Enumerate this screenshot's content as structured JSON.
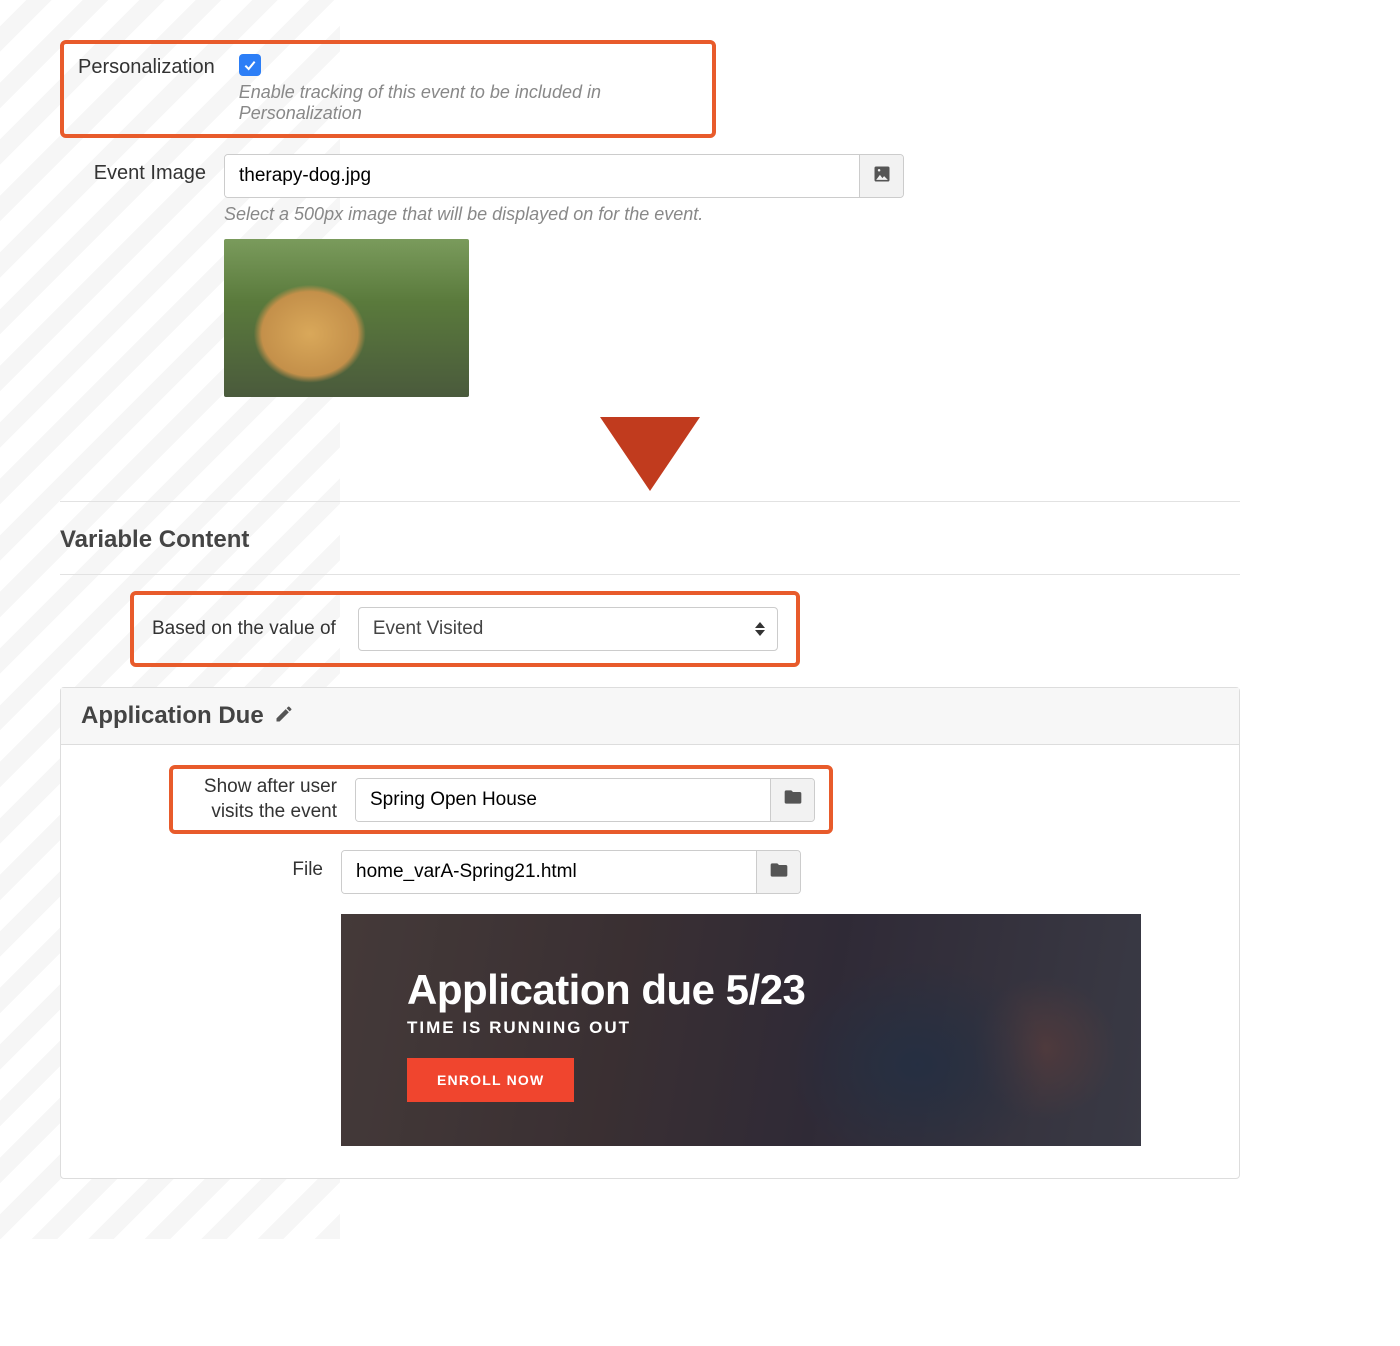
{
  "personalization": {
    "label": "Personalization",
    "checked": true,
    "help": "Enable tracking of this event to be included in Personalization"
  },
  "event_image": {
    "label": "Event Image",
    "value": "therapy-dog.jpg",
    "help": "Select a 500px image that will be displayed on for the event."
  },
  "variable_content": {
    "title": "Variable Content",
    "based_on": {
      "label": "Based on the value of",
      "value": "Event Visited"
    },
    "rule": {
      "title": "Application Due",
      "show_after": {
        "label": "Show after user visits the event",
        "value": "Spring Open House"
      },
      "file": {
        "label": "File",
        "value": "home_varA-Spring21.html"
      }
    }
  },
  "banner": {
    "title": "Application due 5/23",
    "subtitle": "TIME IS RUNNING OUT",
    "cta": "ENROLL NOW"
  }
}
